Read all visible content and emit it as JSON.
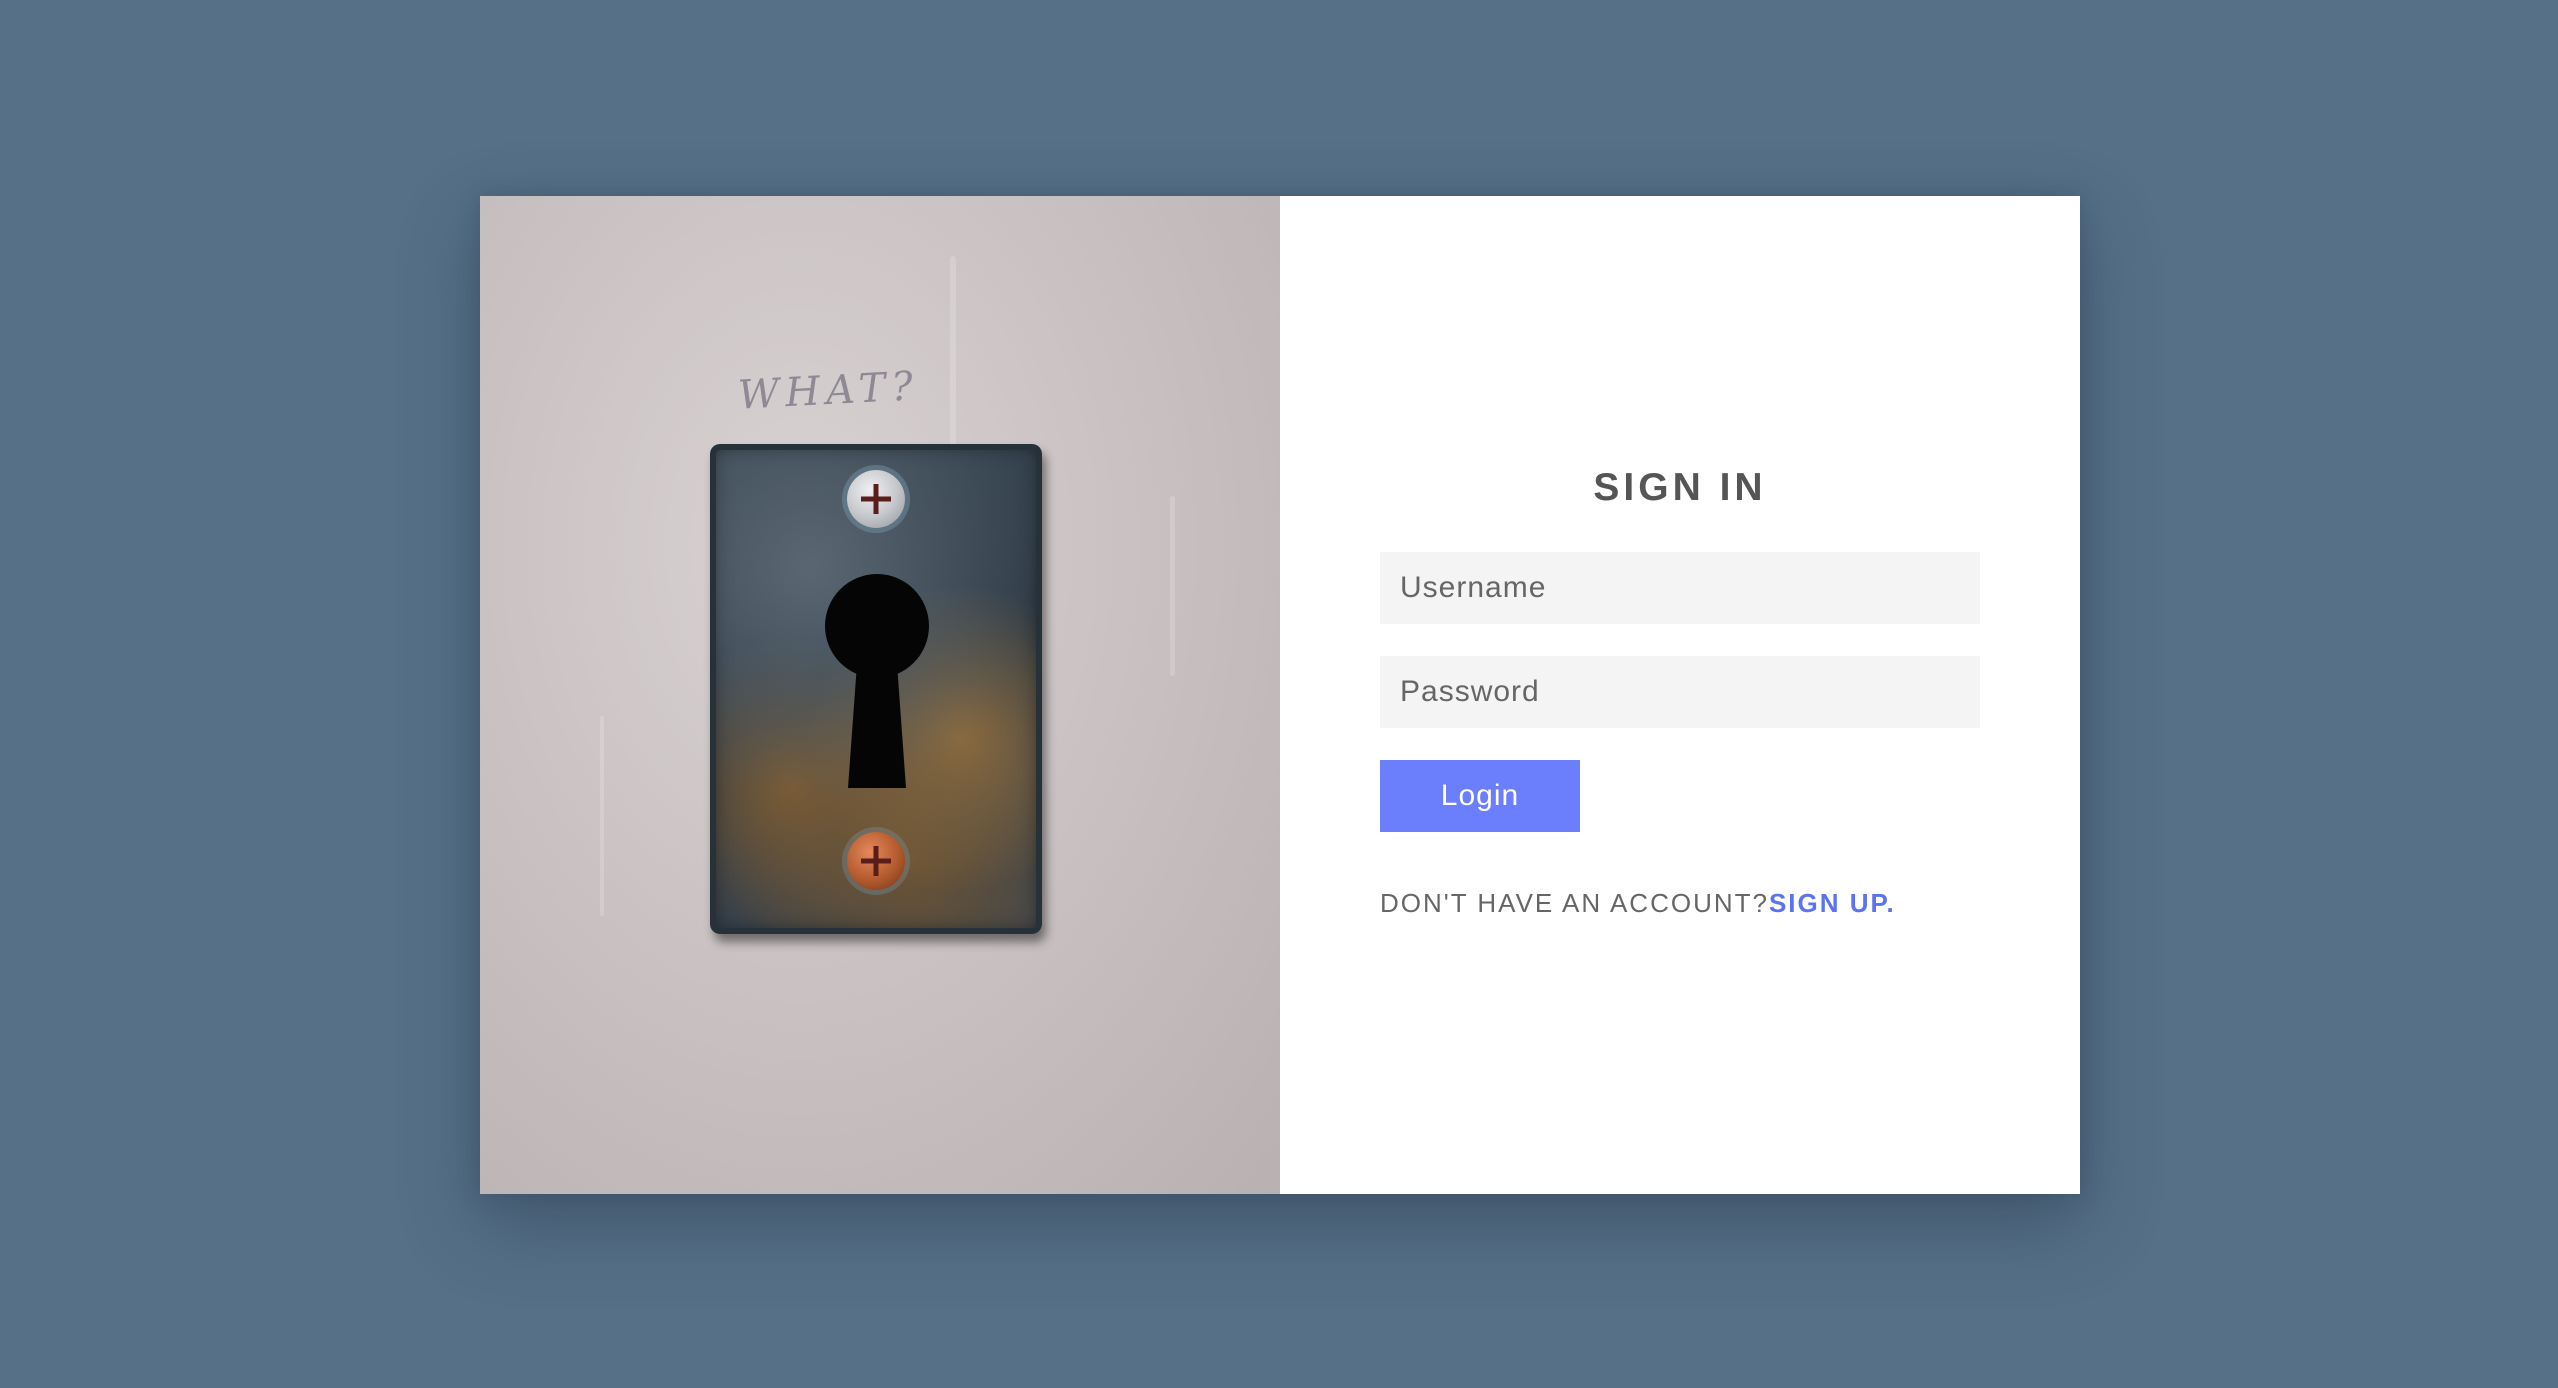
{
  "image": {
    "graffiti_text": "WHAT?"
  },
  "form": {
    "title": "SIGN IN",
    "username_placeholder": "Username",
    "username_value": "",
    "password_placeholder": "Password",
    "password_value": "",
    "login_label": "Login",
    "signup_prompt": "DON'T HAVE AN ACCOUNT?",
    "signup_link": "SIGN UP."
  },
  "colors": {
    "page_background": "#557087",
    "accent": "#6b7efb",
    "link": "#5b73f0",
    "field_background": "#f4f4f4",
    "text": "#555555"
  }
}
